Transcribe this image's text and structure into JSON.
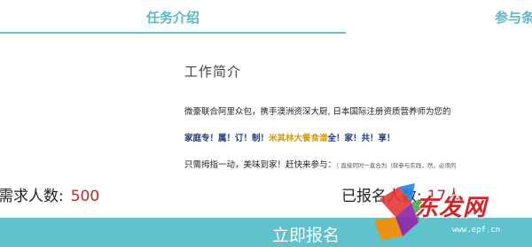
{
  "tabs": [
    {
      "label": "任务介绍",
      "active": true
    },
    {
      "label": "参与条件",
      "active": false
    }
  ],
  "intro": {
    "title": "工作简介",
    "line1": "微豪联合阿里众包，携手澳洲资深大厨, 日本国际注册资质营养师为您的",
    "line2_a": "家庭专！属！订！制！",
    "line2_b": "米其林大餐食谱",
    "line2_c": "全！家！共！享！",
    "line3_a": "只需拇指一动，美味到家！赶快来参与：",
    "line3_b": "（ 直接同时一直合为（就参与实践，然，必须的"
  },
  "stats": {
    "need_label": "需求人数:",
    "need_value": "500",
    "registered_label": "已报名人数:",
    "registered_value": "17人"
  },
  "action": {
    "signup_label": "立即报名"
  },
  "watermark": {
    "text": "东发网",
    "url": "www.epf.cn"
  },
  "colors": {
    "accent": "#5fc2cc",
    "tab_text": "#5ab8c3",
    "number_red": "#c62828",
    "highlight_blue": "#1e3a8a",
    "highlight_gold": "#d8a000"
  }
}
